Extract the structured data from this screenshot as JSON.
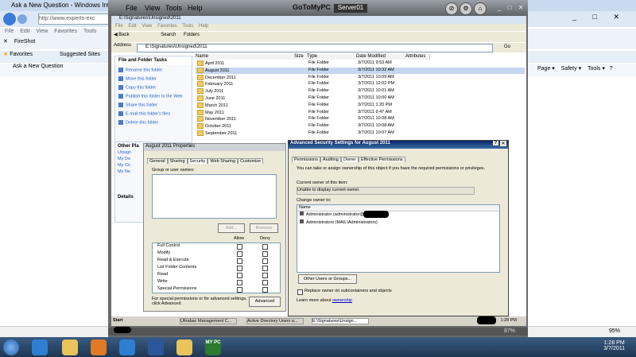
{
  "ie": {
    "title": "Ask a New Question - Windows Internet Explorer",
    "url": "http://www.experts-exc",
    "menu": [
      "File",
      "Edit",
      "View",
      "Favorites",
      "Tools"
    ],
    "fireshot": "FireShot",
    "favorites": "Favorites",
    "suggested_sites": "Suggested Sites",
    "tab": "Ask a New Question",
    "right_tools": [
      "Page",
      "Safety",
      "Tools"
    ],
    "zoom": "95%"
  },
  "g2p": {
    "menu": [
      "File",
      "View",
      "Tools",
      "Help"
    ],
    "logo": "GoToMyPC",
    "server": "Server01",
    "zoom": "87%"
  },
  "explorer": {
    "title": "E:\\Signatures\\Unsigned\\2011",
    "menu": [
      "File",
      "Edit",
      "View",
      "Favorites",
      "Tools",
      "Help"
    ],
    "back": "Back",
    "search": "Search",
    "folders": "Folders",
    "address_label": "Address",
    "address": "E:\\Signatures\\Unsigned\\2011",
    "go": "Go",
    "task_header": "File and Folder Tasks",
    "tasks": [
      "Rename this folder",
      "Move this folder",
      "Copy this folder",
      "Publish this folder to the Web",
      "Share this folder",
      "E-mail this folder's files",
      "Delete this folder"
    ],
    "other_places": "Other Pla",
    "other_items": [
      "Unsign",
      "My Do",
      "My Co",
      "My Ne"
    ],
    "details": "Details",
    "columns": [
      "Name",
      "Size",
      "Type",
      "Date Modified",
      "Attributes"
    ],
    "rows": [
      {
        "name": "April 2011",
        "type": "File Folder",
        "date": "3/7/2011 9:53 AM"
      },
      {
        "name": "August 2011",
        "type": "File Folder",
        "date": "3/7/2011 10:32 AM"
      },
      {
        "name": "December 2011",
        "type": "File Folder",
        "date": "3/7/2011 10:09 AM"
      },
      {
        "name": "February 2011",
        "type": "File Folder",
        "date": "3/7/2011 12:02 PM"
      },
      {
        "name": "July 2011",
        "type": "File Folder",
        "date": "3/7/2011 10:01 AM"
      },
      {
        "name": "June 2011",
        "type": "File Folder",
        "date": "3/7/2011 10:00 AM"
      },
      {
        "name": "March 2011",
        "type": "File Folder",
        "date": "3/7/2011 1:20 PM"
      },
      {
        "name": "May 2011",
        "type": "File Folder",
        "date": "3/7/2011 9:47 AM"
      },
      {
        "name": "November 2011",
        "type": "File Folder",
        "date": "3/7/2011 10:08 AM"
      },
      {
        "name": "October 2011",
        "type": "File Folder",
        "date": "3/7/2011 10:08 AM"
      },
      {
        "name": "September 2011",
        "type": "File Folder",
        "date": "3/7/2011 10:07 AM"
      }
    ]
  },
  "props": {
    "title": "August 2011 Properties",
    "tabs": [
      "General",
      "Sharing",
      "Security",
      "Web Sharing",
      "Customize"
    ],
    "group_label": "Group or user names:",
    "add": "Add...",
    "remove": "Remove",
    "allow": "Allow",
    "deny": "Deny",
    "perms": [
      "Full Control",
      "Modify",
      "Read & Execute",
      "List Folder Contents",
      "Read",
      "Write",
      "Special Permissions"
    ],
    "special_text": "For special permissions or for advanced settings, click Advanced.",
    "advanced": "Advanced"
  },
  "adv": {
    "title": "Advanced Security Settings for August 2011",
    "tabs": [
      "Permissions",
      "Auditing",
      "Owner",
      "Effective Permissions"
    ],
    "intro": "You can take or assign ownership of this object if you have the required permissions or privileges.",
    "current_owner_label": "Current owner of this item:",
    "current_owner": "Unable to display current owner.",
    "change_owner_label": "Change owner to:",
    "name_col": "Name",
    "owners": [
      "Administrator (administrator@",
      "Administrators (MAIL\\Administrators)"
    ],
    "other_users": "Other Users or Groups...",
    "replace": "Replace owner on subcontainers and objects",
    "learn_more": "Learn more about",
    "ownership": "ownership"
  },
  "remote_taskbar": {
    "start": "Start",
    "items": [
      "Ultrabac Management C...",
      "Active Directory Users a...",
      "E:\\Signatures\\Unsign..."
    ],
    "time": "1:28 PM"
  },
  "taskbar": {
    "time": "1:28 PM",
    "date": "3/7/2011",
    "mypc": "MY PC"
  }
}
